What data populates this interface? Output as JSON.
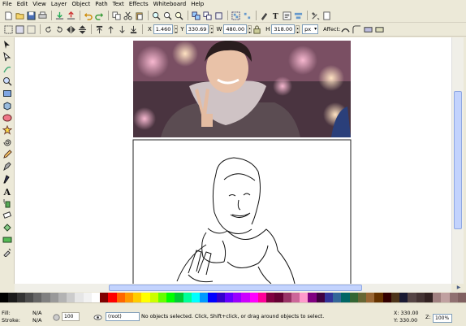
{
  "menu": [
    "File",
    "Edit",
    "View",
    "Layer",
    "Object",
    "Path",
    "Text",
    "Effects",
    "Whiteboard",
    "Help"
  ],
  "toolbar_icons": [
    "new-icon",
    "open-icon",
    "save-icon",
    "print-icon",
    "import-icon",
    "export-icon",
    "undo-icon",
    "redo-icon",
    "copy-icon",
    "cut-icon",
    "paste-icon",
    "zoom-selection-icon",
    "zoom-drawing-icon",
    "zoom-page-icon",
    "duplicate-icon",
    "clone-icon",
    "unlink-clone-icon",
    "group-icon",
    "ungroup-icon",
    "fill-stroke-icon",
    "text-font-icon",
    "xml-editor-icon",
    "align-icon",
    "preferences-icon"
  ],
  "controls": {
    "x_label": "X",
    "x_value": "1.460",
    "y_label": "Y",
    "y_value": "330.69",
    "w_label": "W",
    "w_value": "480.00",
    "h_label": "H",
    "h_value": "318.00",
    "unit": "px",
    "affect_label": "Affect:"
  },
  "tools": [
    "selector-icon",
    "node-icon",
    "tweak-icon",
    "zoom-icon",
    "rectangle-icon",
    "3d-box-icon",
    "ellipse-icon",
    "star-icon",
    "spiral-icon",
    "pencil-icon",
    "pen-icon",
    "calligraphy-icon",
    "text-icon",
    "spray-icon",
    "eraser-icon",
    "paint-bucket-icon",
    "gradient-icon",
    "dropper-icon"
  ],
  "status": {
    "fill_label": "Fill:",
    "fill_value": "N/A",
    "stroke_label": "Stroke:",
    "stroke_value": "N/A",
    "opacity": "100",
    "layer": "(root)",
    "message": "No objects selected. Click, Shift+click, or drag around objects to select.",
    "x_label": "X:",
    "x_value": "330.00",
    "y_label": "Y:",
    "y_value": "330.00",
    "zoom_label": "Z:",
    "zoom_value": "100%"
  },
  "palette": [
    "#000000",
    "#1a1a1a",
    "#333333",
    "#4d4d4d",
    "#666666",
    "#808080",
    "#999999",
    "#b3b3b3",
    "#cccccc",
    "#e6e6e6",
    "#f2f2f2",
    "#ffffff",
    "#800000",
    "#ff0000",
    "#ff6600",
    "#ff9900",
    "#ffcc00",
    "#ffff00",
    "#ccff00",
    "#66ff00",
    "#00ff00",
    "#00cc33",
    "#00ff99",
    "#00ffff",
    "#0099ff",
    "#0000ff",
    "#3300cc",
    "#6600ff",
    "#9900ff",
    "#cc00ff",
    "#ff00ff",
    "#ff0099",
    "#800040",
    "#660033",
    "#993366",
    "#cc6699",
    "#ff99cc",
    "#800080",
    "#400040",
    "#333399",
    "#336699",
    "#006666",
    "#336633",
    "#666633",
    "#996633",
    "#663300",
    "#330000",
    "#4d3319",
    "#1a1a33",
    "#554444",
    "#443333",
    "#332222",
    "#a08080",
    "#c0a0a0",
    "#907070",
    "#806060"
  ],
  "colors": {
    "chrome": "#ece9d8",
    "canvas": "#ffffff",
    "scroll_thumb": "#c3d3fd"
  }
}
